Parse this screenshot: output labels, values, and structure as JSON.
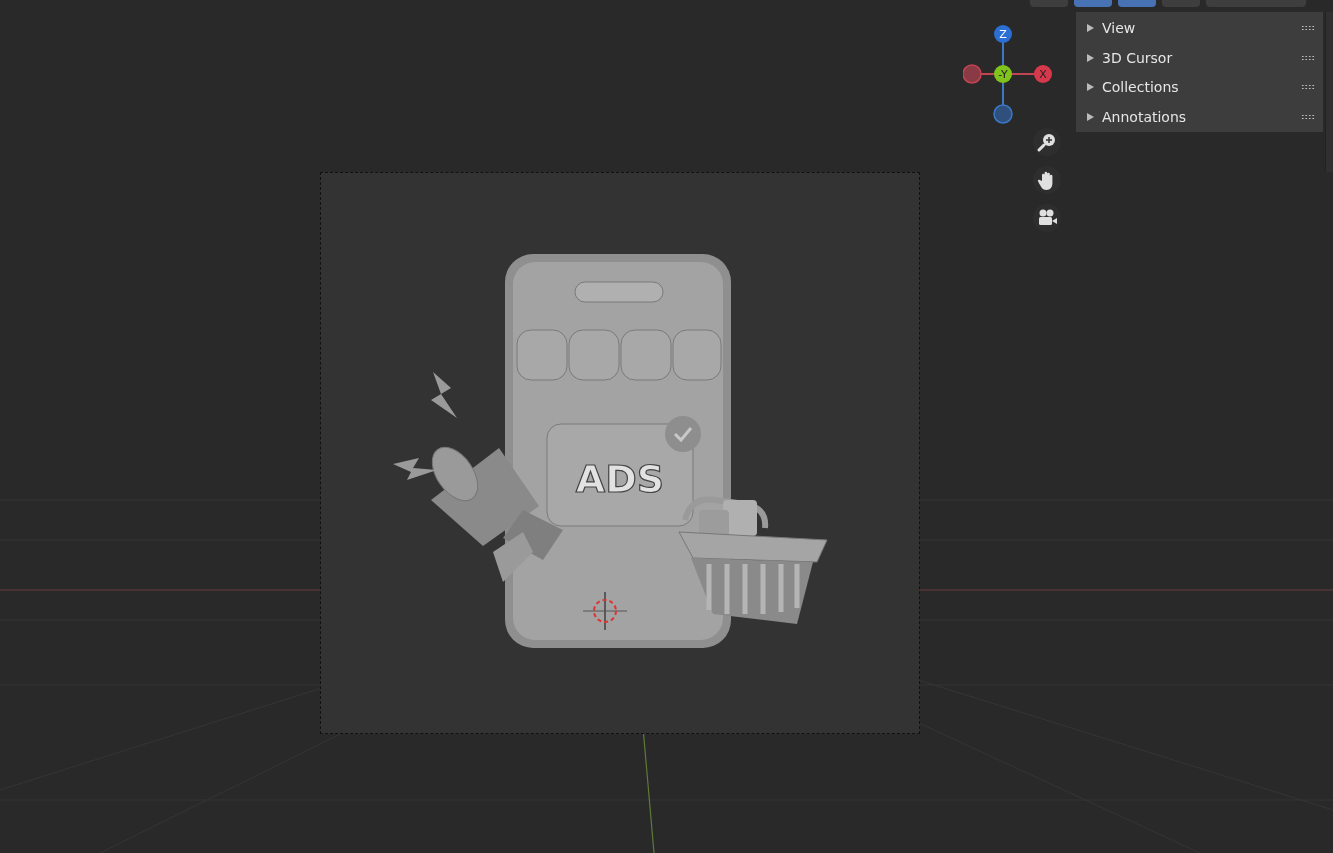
{
  "gizmo": {
    "axes": [
      {
        "kind": "z",
        "label": "Z"
      },
      {
        "kind": "y",
        "label": "-Y"
      },
      {
        "kind": "x",
        "label": "X"
      }
    ]
  },
  "sidebar": {
    "panels": [
      {
        "label": "View",
        "expanded": false
      },
      {
        "label": "3D Cursor",
        "expanded": false
      },
      {
        "label": "Collections",
        "expanded": false
      },
      {
        "label": "Annotations",
        "expanded": false
      }
    ]
  },
  "model": {
    "label": "ADS"
  }
}
